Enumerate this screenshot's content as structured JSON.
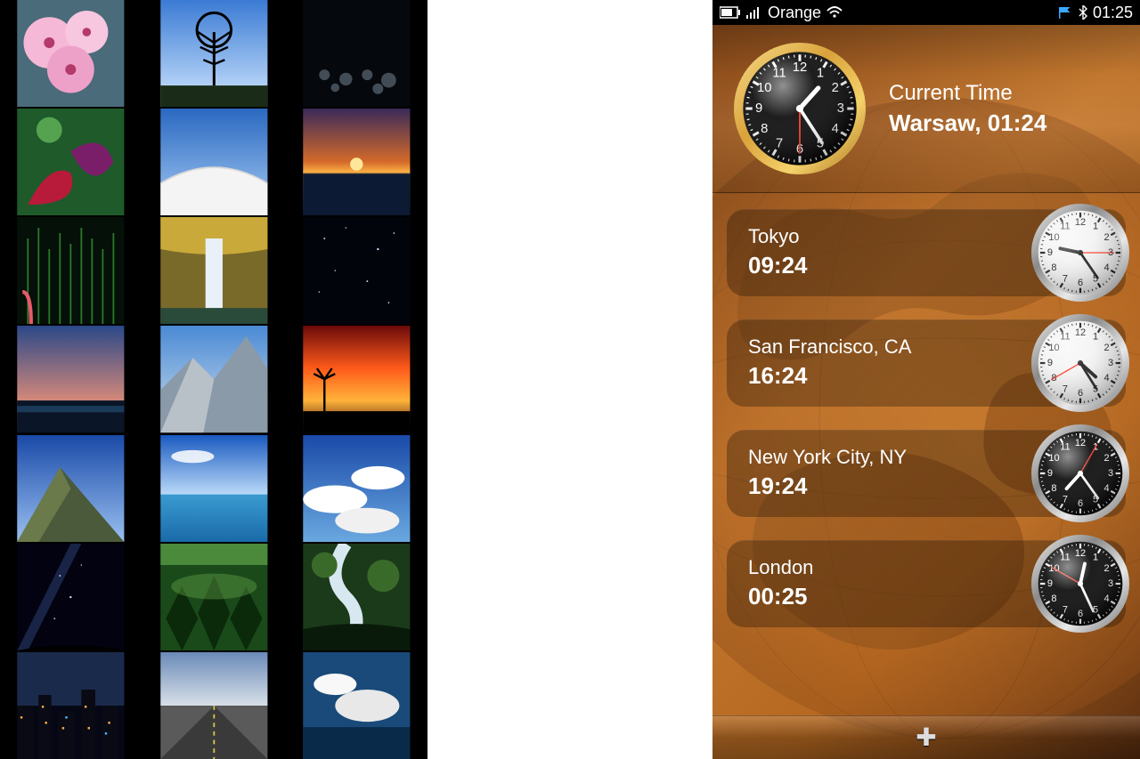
{
  "gallery": {
    "thumbs": [
      {
        "name": "blossom",
        "kind": "flowers"
      },
      {
        "name": "lone-tree",
        "kind": "tree"
      },
      {
        "name": "night-bokeh",
        "kind": "bokeh"
      },
      {
        "name": "petals",
        "kind": "petals"
      },
      {
        "name": "snow-dune",
        "kind": "dune"
      },
      {
        "name": "sunset-beach",
        "kind": "sunsetbeach"
      },
      {
        "name": "reeds",
        "kind": "reeds"
      },
      {
        "name": "waterfall",
        "kind": "waterfall"
      },
      {
        "name": "stars",
        "kind": "stars"
      },
      {
        "name": "twilight-city",
        "kind": "twilight"
      },
      {
        "name": "yosemite",
        "kind": "yosemite"
      },
      {
        "name": "palm-sunset",
        "kind": "palmsunset"
      },
      {
        "name": "mountain-ridge",
        "kind": "ridge"
      },
      {
        "name": "horizon",
        "kind": "horizon"
      },
      {
        "name": "clouds",
        "kind": "clouds"
      },
      {
        "name": "milky-way",
        "kind": "milkyway"
      },
      {
        "name": "forest",
        "kind": "forest"
      },
      {
        "name": "stream",
        "kind": "stream"
      },
      {
        "name": "city-night",
        "kind": "citynight"
      },
      {
        "name": "road",
        "kind": "road"
      },
      {
        "name": "sky-clouds",
        "kind": "skyclouds"
      }
    ]
  },
  "statusbar": {
    "carrier": "Orange",
    "time": "01:25"
  },
  "hero": {
    "title": "Current Time",
    "subtitle": "Warsaw, 01:24",
    "hour": 1,
    "minute": 24,
    "second": 30,
    "face": "black",
    "bezel": "gold",
    "size": 148
  },
  "world_clocks": [
    {
      "city": "Tokyo",
      "time": "09:24",
      "hour": 9,
      "minute": 24,
      "second": 15,
      "face": "white",
      "bezel": "silver"
    },
    {
      "city": "San Francisco, CA",
      "time": "16:24",
      "hour": 16,
      "minute": 24,
      "second": 40,
      "face": "white",
      "bezel": "silver"
    },
    {
      "city": "New York City, NY",
      "time": "19:24",
      "hour": 19,
      "minute": 24,
      "second": 5,
      "face": "black",
      "bezel": "silver"
    },
    {
      "city": "London",
      "time": "00:25",
      "hour": 0,
      "minute": 25,
      "second": 50,
      "face": "black",
      "bezel": "silver"
    }
  ],
  "addbar": {
    "label": "✚"
  }
}
